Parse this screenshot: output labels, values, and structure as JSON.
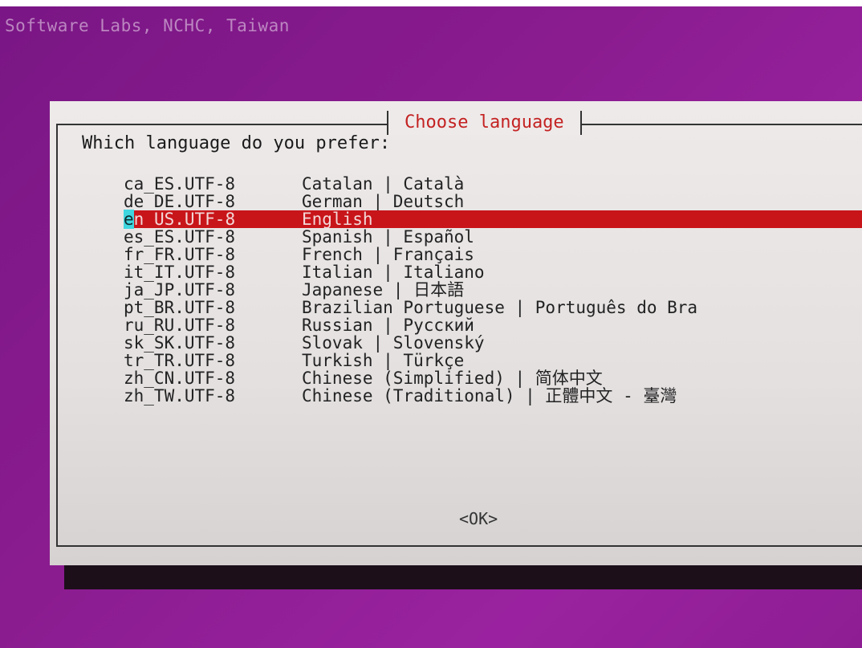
{
  "screen": {
    "backtitle": "Software Labs, NCHC, Taiwan"
  },
  "dialog": {
    "title": "Choose language",
    "prompt": "Which language do you prefer:",
    "items": [
      {
        "code": "ca_ES.UTF-8",
        "label": "Catalan | Català"
      },
      {
        "code": "de_DE.UTF-8",
        "label": "German | Deutsch"
      },
      {
        "code": "en_US.UTF-8",
        "label": "English",
        "selected": true
      },
      {
        "code": "es_ES.UTF-8",
        "label": "Spanish | Español"
      },
      {
        "code": "fr_FR.UTF-8",
        "label": "French | Français"
      },
      {
        "code": "it_IT.UTF-8",
        "label": "Italian | Italiano"
      },
      {
        "code": "ja_JP.UTF-8",
        "label": "Japanese | 日本語"
      },
      {
        "code": "pt_BR.UTF-8",
        "label": "Brazilian Portuguese | Português do Bra"
      },
      {
        "code": "ru_RU.UTF-8",
        "label": "Russian | Русский"
      },
      {
        "code": "sk_SK.UTF-8",
        "label": "Slovak | Slovenský"
      },
      {
        "code": "tr_TR.UTF-8",
        "label": "Turkish | Türkçe"
      },
      {
        "code": "zh_CN.UTF-8",
        "label": "Chinese (Simplified) | 简体中文"
      },
      {
        "code": "zh_TW.UTF-8",
        "label": "Chinese (Traditional) | 正體中文 - 臺灣"
      }
    ],
    "ok_label": "<OK>"
  },
  "colors": {
    "background": "#8a1c8f",
    "dialog": "#e8e4e4",
    "title": "#c42222",
    "selection": "#c8151a",
    "cursor": "#3fd6df",
    "shadow": "#1c0f1a"
  }
}
